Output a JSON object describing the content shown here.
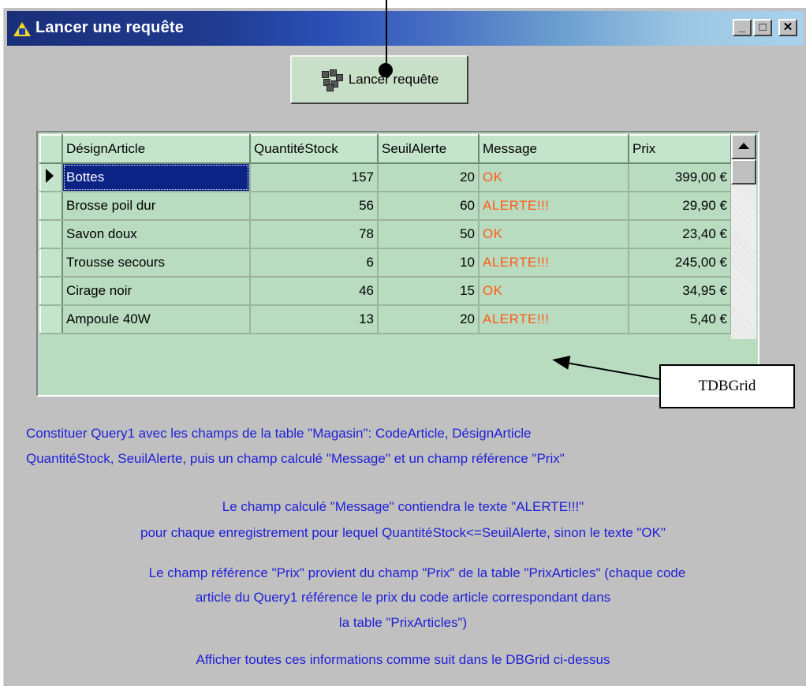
{
  "window": {
    "title": "Lancer une requête",
    "controls": {
      "minimize": "_",
      "maximize": "□",
      "close": "✕"
    }
  },
  "toolbar": {
    "launch_label": "Lancer requête",
    "launch_icon": "query-icon"
  },
  "grid": {
    "columns": [
      "DésignArticle",
      "QuantitéStock",
      "SeuilAlerte",
      "Message",
      "Prix"
    ],
    "rows": [
      {
        "designation": "Bottes",
        "quantite": "157",
        "seuil": "20",
        "message": "OK",
        "prix": "399,00 €",
        "selected": true
      },
      {
        "designation": "Brosse poil dur",
        "quantite": "56",
        "seuil": "60",
        "message": "ALERTE!!!",
        "prix": "29,90 €"
      },
      {
        "designation": "Savon doux",
        "quantite": "78",
        "seuil": "50",
        "message": "OK",
        "prix": "23,40 €"
      },
      {
        "designation": "Trousse secours",
        "quantite": "6",
        "seuil": "10",
        "message": "ALERTE!!!",
        "prix": "245,00 €"
      },
      {
        "designation": "Cirage noir",
        "quantite": "46",
        "seuil": "15",
        "message": "OK",
        "prix": "34,95 €"
      },
      {
        "designation": "Ampoule 40W",
        "quantite": "13",
        "seuil": "20",
        "message": "ALERTE!!!",
        "prix": "5,40 €"
      }
    ]
  },
  "annotation": {
    "label": "TDBGrid"
  },
  "instructions": {
    "line1": "Constituer Query1 avec les champs de la table \"Magasin\": CodeArticle, DésignArticle",
    "line2": "QuantitéStock, SeuilAlerte, puis un champ calculé \"Message\" et un champ référence \"Prix\"",
    "line3": "Le champ calculé \"Message\" contiendra le texte \"ALERTE!!!\"",
    "line4": "pour chaque enregistrement pour lequel QuantitéStock<=SeuilAlerte, sinon le texte \"OK\"",
    "line5": "Le champ référence \"Prix\" provient du champ \"Prix\" de la table \"PrixArticles\" (chaque code",
    "line6": "article du Query1 référence le prix du code article correspondant dans",
    "line7": "la table \"PrixArticles\")",
    "line8": "Afficher toutes ces informations comme suit dans le DBGrid ci-dessus"
  },
  "colors": {
    "message_text": "#ff5a14",
    "instruction_text": "#2020d8",
    "grid_bg": "#b9dcc1",
    "selection": "#0b2385"
  }
}
